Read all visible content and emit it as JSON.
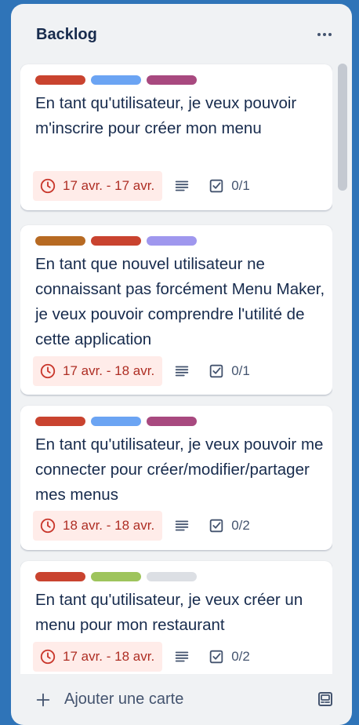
{
  "list": {
    "title": "Backlog",
    "add_card_label": "Ajouter une carte"
  },
  "label_colors": {
    "red": "#c9432f",
    "blue": "#6ba4f3",
    "purple": "#a8497f",
    "orange": "#b76a22",
    "lavender": "#9f97ee",
    "green": "#9ec45c",
    "gray": "#dcdfe4"
  },
  "cards": [
    {
      "labels": [
        "red",
        "blue",
        "purple"
      ],
      "title": "En tant qu'utilisateur, je veux pouvoir m'inscrire pour créer mon menu",
      "dates": "17 avr. - 17 avr.",
      "checklist": "0/1"
    },
    {
      "labels": [
        "orange",
        "red",
        "lavender"
      ],
      "title": "En tant que nouvel utilisateur ne connaissant pas forcément Menu Maker, je veux pouvoir comprendre l'utilité de cette application",
      "dates": "17 avr. - 18 avr.",
      "checklist": "0/1"
    },
    {
      "labels": [
        "red",
        "blue",
        "purple"
      ],
      "title": "En tant qu'utilisateur, je veux pouvoir me connecter pour créer/modifier/partager mes menus",
      "dates": "18 avr. - 18 avr.",
      "checklist": "0/2"
    },
    {
      "labels": [
        "red",
        "green",
        "gray"
      ],
      "title": "En tant qu'utilisateur, je veux créer un menu pour mon restaurant",
      "dates": "17 avr. - 18 avr.",
      "checklist": "0/2"
    }
  ]
}
